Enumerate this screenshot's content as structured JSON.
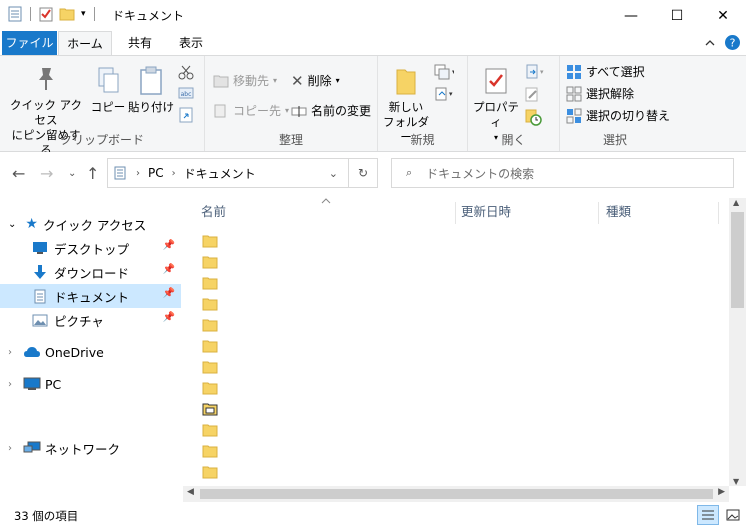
{
  "window": {
    "title": "ドキュメント",
    "controls": {
      "minimize": "—",
      "maximize": "☐",
      "close": "✕"
    }
  },
  "ribbon_tabs": {
    "file": "ファイル",
    "home": "ホーム",
    "share": "共有",
    "view": "表示",
    "help": "^"
  },
  "ribbon": {
    "clipboard": {
      "label": "クリップボード",
      "pin_quick": [
        "クイック アクセス",
        "にピン留めする"
      ],
      "copy": "コピー",
      "paste": "貼り付け"
    },
    "organize": {
      "label": "整理",
      "move_to": "移動先",
      "copy_to": "コピー先",
      "delete": "削除",
      "rename": "名前の変更"
    },
    "new": {
      "label": "新規",
      "new_folder": [
        "新しい",
        "フォルダー"
      ]
    },
    "open": {
      "label": "開く",
      "properties": "プロパティ"
    },
    "select": {
      "label": "選択",
      "select_all": "すべて選択",
      "select_none": "選択解除",
      "invert": "選択の切り替え"
    }
  },
  "address": {
    "path": [
      "PC",
      "ドキュメント"
    ],
    "search_placeholder": "ドキュメントの検索"
  },
  "navpane": {
    "quick_access": "クイック アクセス",
    "items": [
      {
        "label": "デスクトップ"
      },
      {
        "label": "ダウンロード"
      },
      {
        "label": "ドキュメント"
      },
      {
        "label": "ピクチャ"
      }
    ],
    "onedrive": "OneDrive",
    "pc": "PC",
    "network": "ネットワーク"
  },
  "columns": {
    "name": "名前",
    "modified": "更新日時",
    "type": "種類"
  },
  "status": {
    "item_count": "33 個の項目"
  },
  "colors": {
    "accent": "#1979ca",
    "selection": "#cce8ff",
    "folder": "#f6d365"
  }
}
